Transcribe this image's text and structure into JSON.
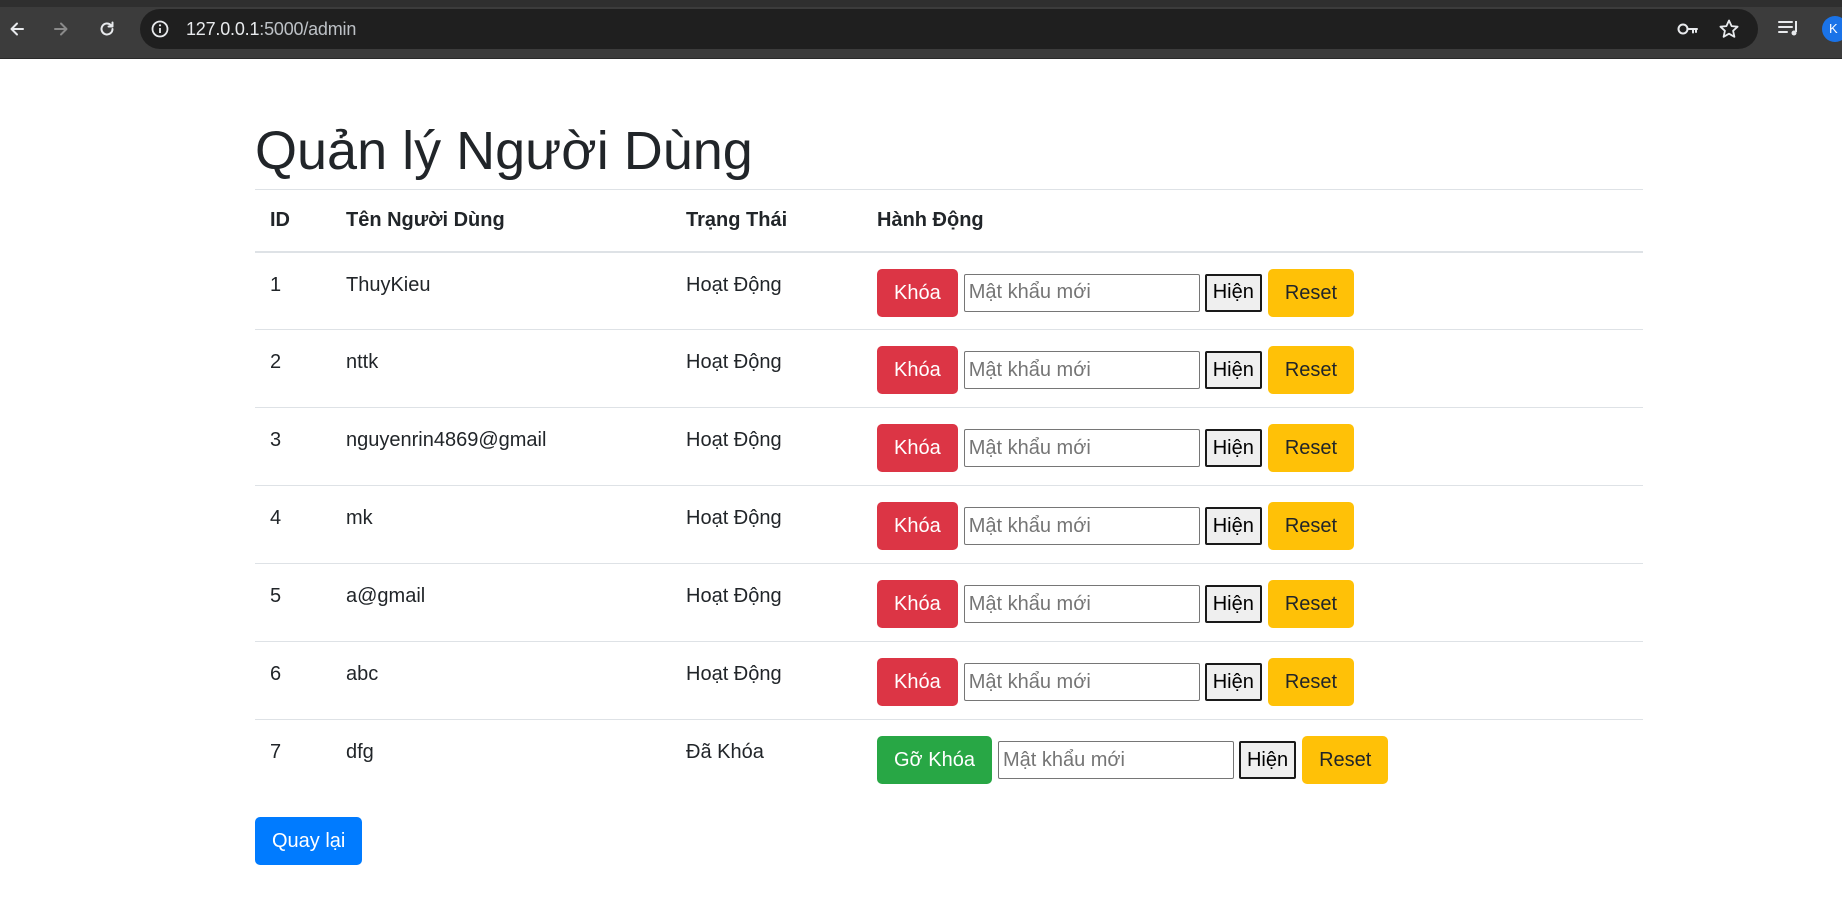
{
  "browser": {
    "url_host": "127.0.0.1",
    "url_rest": ":5000/admin",
    "avatar_letter": "K"
  },
  "page": {
    "title": "Quản lý Người Dùng",
    "back_label": "Quay lại"
  },
  "table": {
    "headers": [
      "ID",
      "Tên Người Dùng",
      "Trạng Thái",
      "Hành Động"
    ],
    "rows": [
      {
        "id": "1",
        "name": "ThuyKieu",
        "status": "Hoạt Động",
        "toggle_label": "Khóa",
        "toggle_type": "danger"
      },
      {
        "id": "2",
        "name": "nttk",
        "status": "Hoạt Động",
        "toggle_label": "Khóa",
        "toggle_type": "danger"
      },
      {
        "id": "3",
        "name": "nguyenrin4869@gmail",
        "status": "Hoạt Động",
        "toggle_label": "Khóa",
        "toggle_type": "danger"
      },
      {
        "id": "4",
        "name": "mk",
        "status": "Hoạt Động",
        "toggle_label": "Khóa",
        "toggle_type": "danger"
      },
      {
        "id": "5",
        "name": "a@gmail",
        "status": "Hoạt Động",
        "toggle_label": "Khóa",
        "toggle_type": "danger"
      },
      {
        "id": "6",
        "name": "abc",
        "status": "Hoạt Động",
        "toggle_label": "Khóa",
        "toggle_type": "danger"
      },
      {
        "id": "7",
        "name": "dfg",
        "status": "Đã Khóa",
        "toggle_label": "Gỡ Khóa",
        "toggle_type": "success"
      }
    ],
    "password_placeholder": "Mật khẩu mới",
    "show_label": "Hiện",
    "reset_label": "Reset"
  },
  "colors": {
    "danger": "#dc3545",
    "success": "#28a745",
    "warning": "#ffc107",
    "primary": "#007bff"
  },
  "icons": [
    "back-arrow-icon",
    "forward-arrow-icon",
    "reload-icon",
    "info-icon",
    "key-icon",
    "star-icon",
    "media-queue-icon"
  ]
}
